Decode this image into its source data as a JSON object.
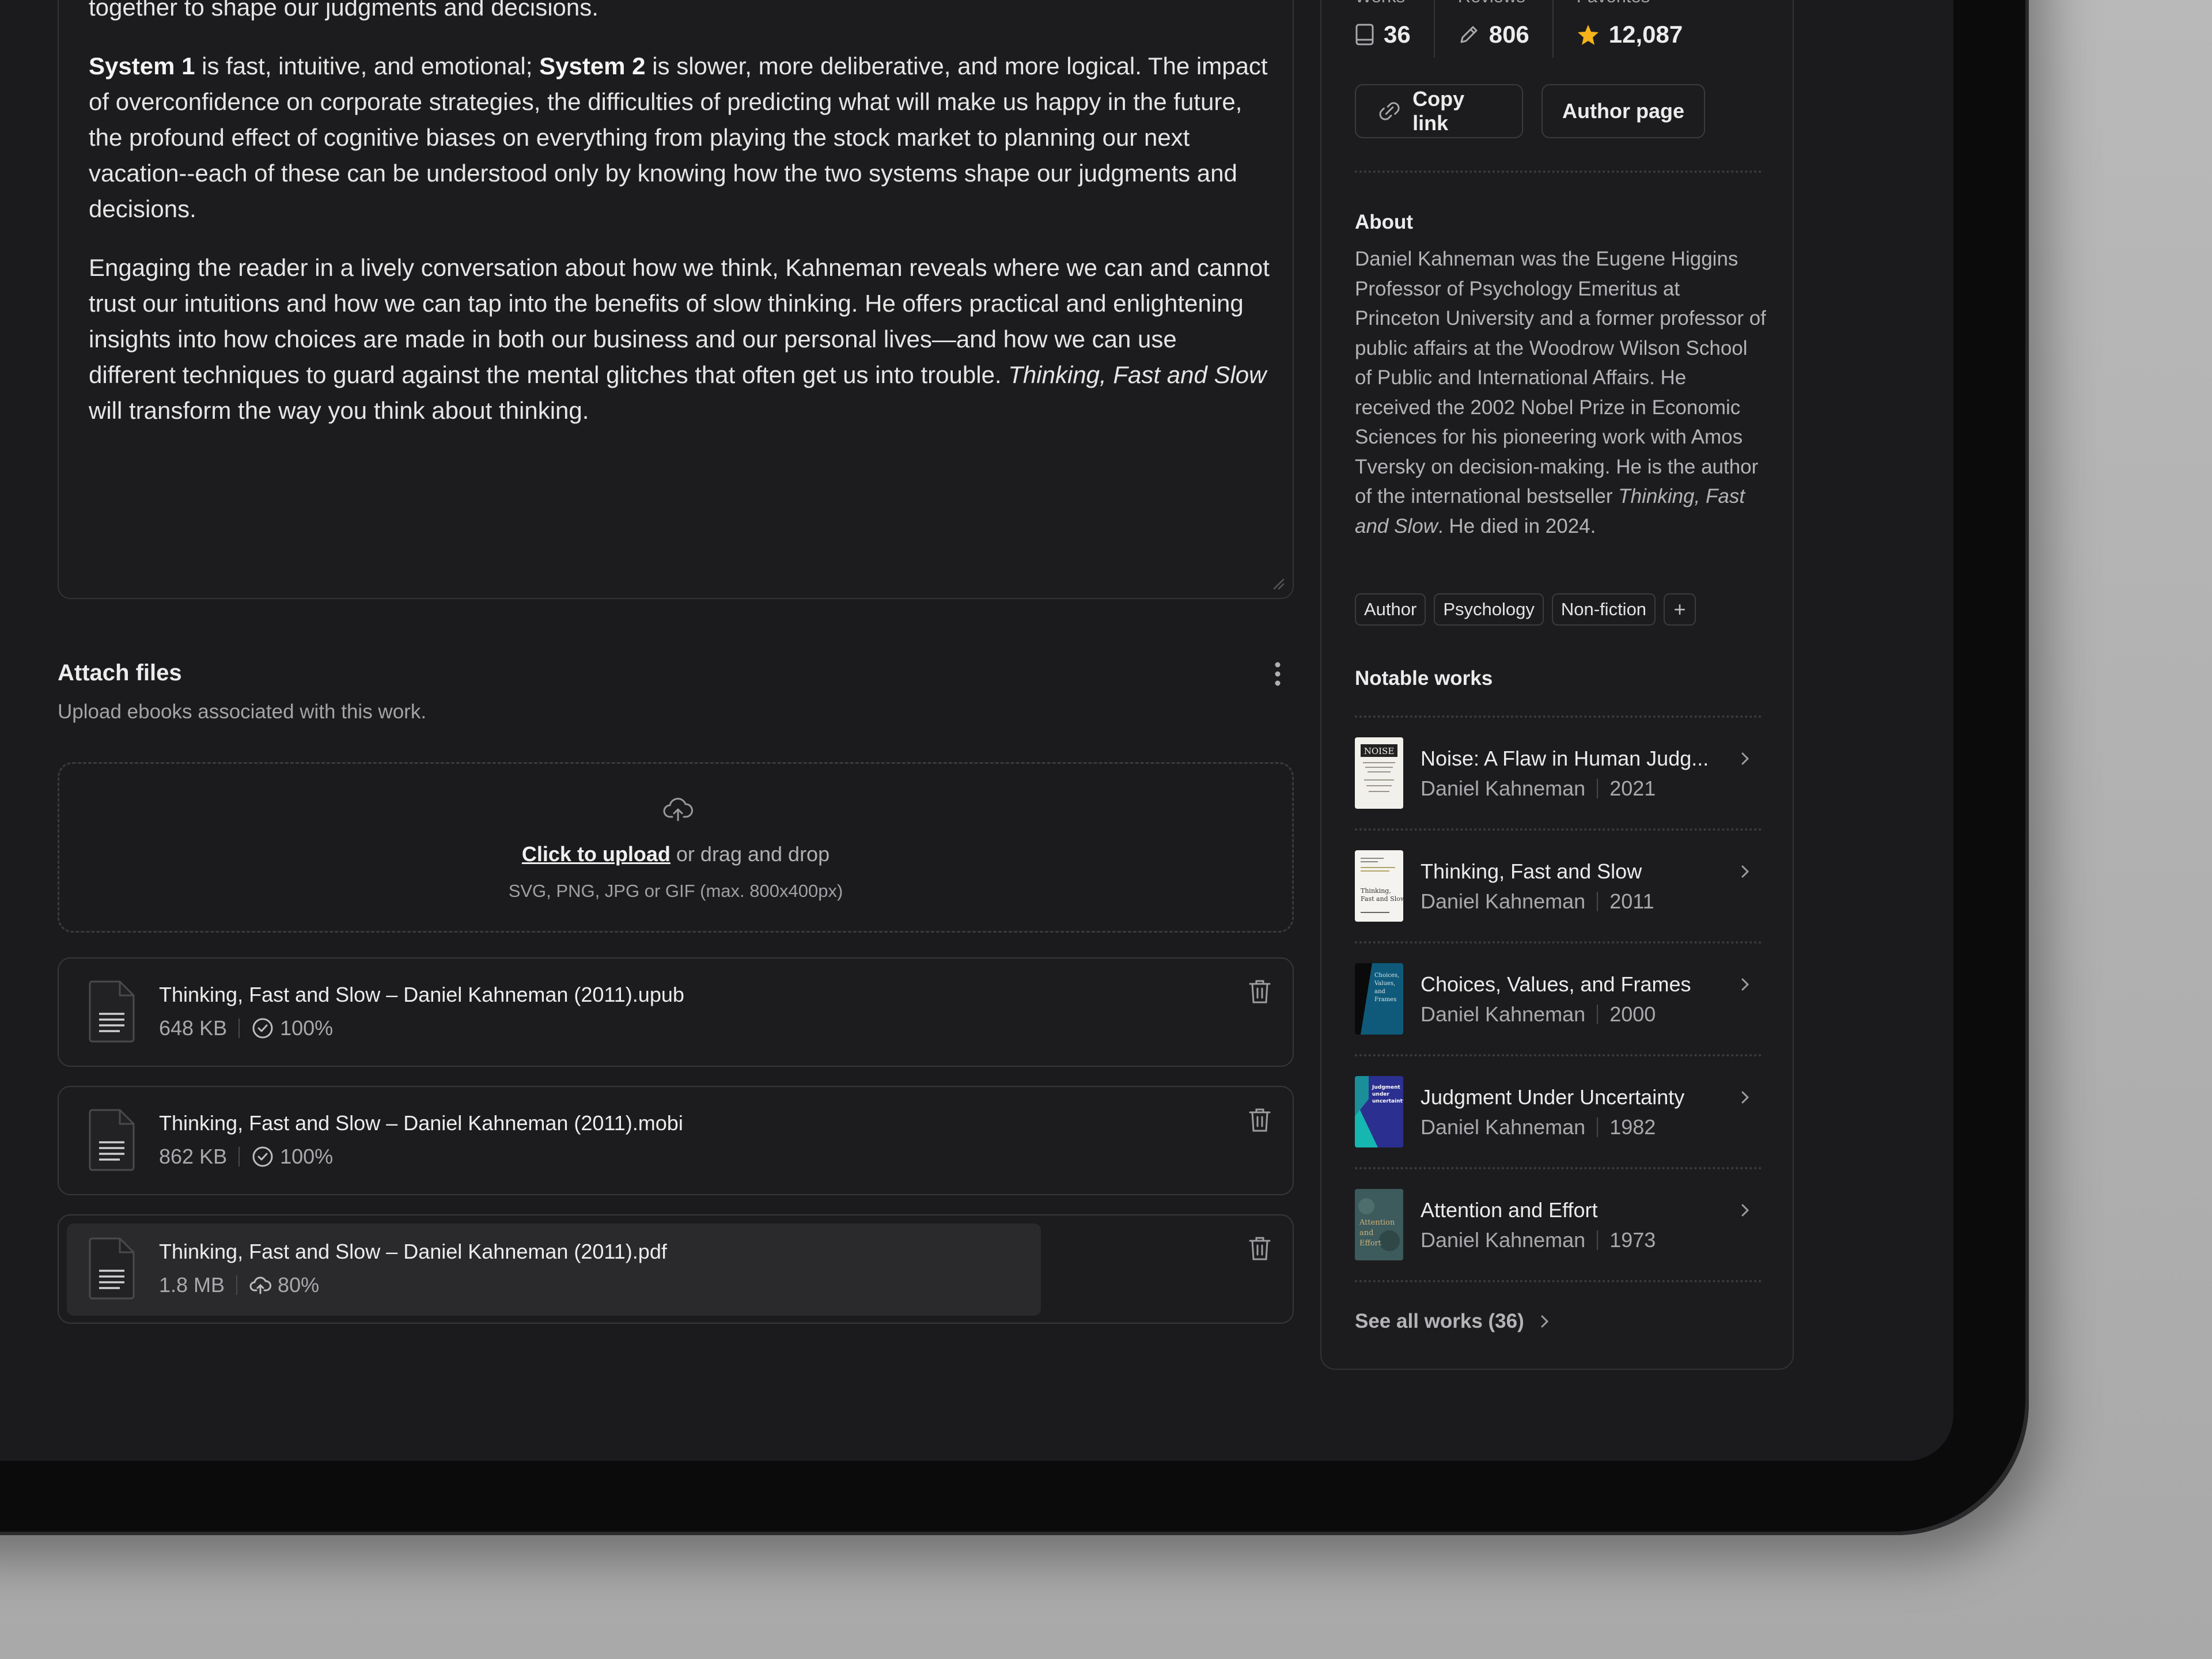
{
  "description": {
    "partial_top": "planning the next vacation--each of these can be understood only by knowing how the two systems work together to shape our judgments and decisions.",
    "p1_bold1": "System 1",
    "p1_mid": " is fast, intuitive, and emotional; ",
    "p1_bold2": "System 2",
    "p1_rest": " is slower, more deliberative, and more logical. The impact of overconfidence on corporate strategies, the difficulties of predicting what will make us happy in the future, the profound effect of cognitive biases on everything from playing the stock market to planning our next vacation--each of these can be understood only by knowing how the two systems shape our judgments and decisions.",
    "p2_main": "Engaging the reader in a lively conversation about how we think, Kahneman reveals where we can and cannot trust our intuitions and how we can tap into the benefits of slow thinking. He offers practical and enlightening insights into how choices are made in both our business and our personal lives—and how we can use different techniques to guard against the mental glitches that often get us into trouble. ",
    "p2_italic": "Thinking, Fast and Slow",
    "p2_end": " will transform the way you think about thinking."
  },
  "attach": {
    "title": "Attach files",
    "subtitle": "Upload ebooks associated with this work.",
    "upload_link": "Click to upload",
    "upload_rest": " or drag and drop",
    "upload_hint": "SVG, PNG, JPG or GIF (max. 800x400px)",
    "files": [
      {
        "name": "Thinking, Fast and Slow – Daniel Kahneman (2011).upub",
        "size": "648 KB",
        "progress": "100%",
        "status": "complete"
      },
      {
        "name": "Thinking, Fast and Slow – Daniel Kahneman (2011).mobi",
        "size": "862 KB",
        "progress": "100%",
        "status": "complete"
      },
      {
        "name": "Thinking, Fast and Slow – Daniel Kahneman (2011).pdf",
        "size": "1.8 MB",
        "progress": "80%",
        "status": "uploading",
        "progress_fraction": 0.8
      }
    ]
  },
  "author_panel": {
    "stats": [
      {
        "label": "Works",
        "value": "36",
        "icon": "book-icon"
      },
      {
        "label": "Reviews",
        "value": "806",
        "icon": "pen-icon"
      },
      {
        "label": "Favorites",
        "value": "12,087",
        "icon": "star-icon"
      }
    ],
    "copy_link_label": "Copy link",
    "author_page_label": "Author page",
    "about_title": "About",
    "about_text": "Daniel Kahneman was the Eugene Higgins Professor of Psychology Emeritus at Princeton University and a former professor of public affairs at the Woodrow Wilson School of Public and International Affairs. He received the 2002 Nobel Prize in Economic Sciences for his pioneering work with Amos Tversky on decision-making. He is the author of the international bestseller ",
    "about_italic": "Thinking, Fast and Slow",
    "about_end": ". He died in 2024.",
    "tags": [
      "Author",
      "Psychology",
      "Non-fiction"
    ],
    "tag_add": "+",
    "notable_title": "Notable works",
    "works": [
      {
        "title": "Noise: A Flaw in Human Judg...",
        "author": "Daniel Kahneman",
        "year": "2021"
      },
      {
        "title": "Thinking, Fast and Slow",
        "author": "Daniel Kahneman",
        "year": "2011"
      },
      {
        "title": "Choices, Values, and Frames",
        "author": "Daniel Kahneman",
        "year": "2000"
      },
      {
        "title": "Judgment Under Uncertainty",
        "author": "Daniel Kahneman",
        "year": "1982"
      },
      {
        "title": "Attention and Effort",
        "author": "Daniel Kahneman",
        "year": "1973"
      }
    ],
    "see_all_label": "See all works (36)"
  },
  "colors": {
    "background": "#1b1b1d",
    "text": "#ececec",
    "muted": "#a9a9ad",
    "star": "#f5b31a"
  }
}
